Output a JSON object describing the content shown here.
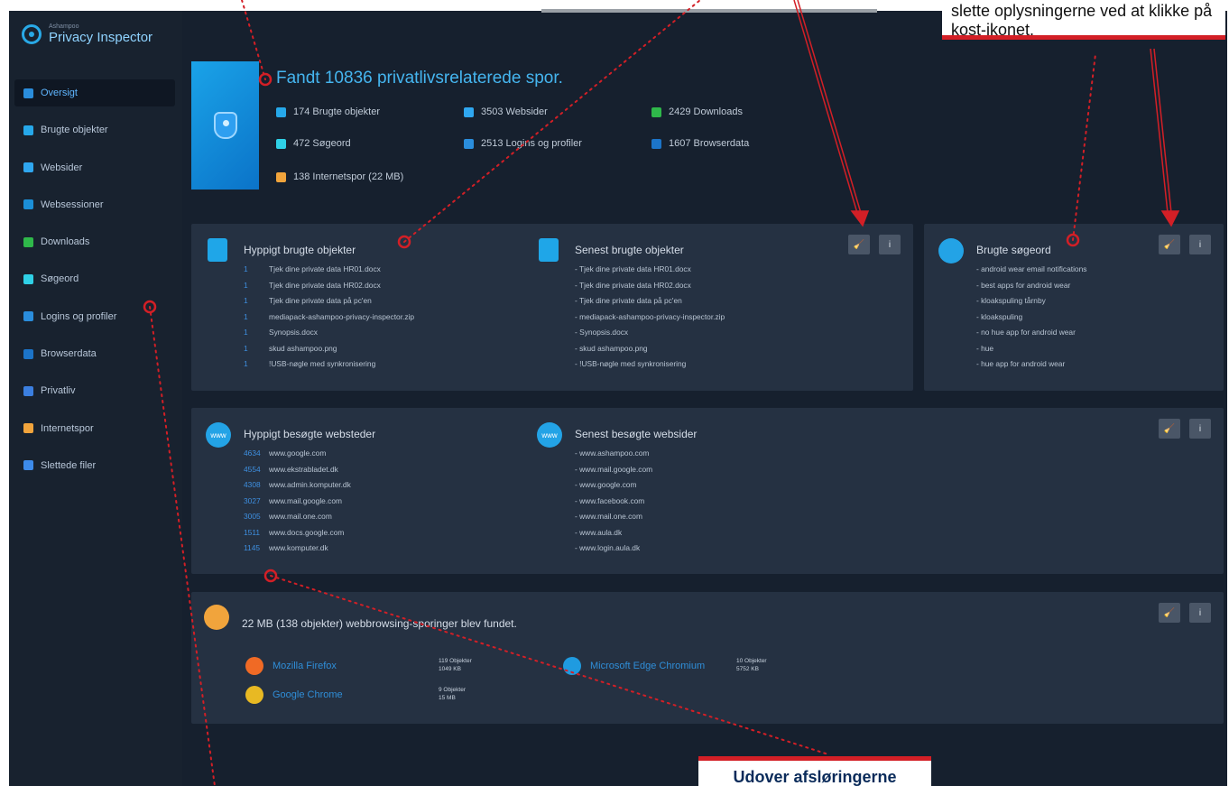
{
  "app": {
    "brand_small": "Ashampoo",
    "title": "Privacy Inspector",
    "close": "×"
  },
  "sidebar": {
    "items": [
      {
        "label": "Oversigt",
        "icon": "overview-icon",
        "color": "#2a8ddc",
        "active": true
      },
      {
        "label": "Brugte objekter",
        "icon": "file-icon",
        "color": "#26a8ea"
      },
      {
        "label": "Websider",
        "icon": "globe-icon",
        "color": "#2fa7f0"
      },
      {
        "label": "Websessioner",
        "icon": "session-icon",
        "color": "#1b8fd8"
      },
      {
        "label": "Downloads",
        "icon": "download-icon",
        "color": "#2fb84a"
      },
      {
        "label": "Søgeord",
        "icon": "search-icon",
        "color": "#2fd0e6"
      },
      {
        "label": "Logins og profiler",
        "icon": "user-icon",
        "color": "#2a8ddc"
      },
      {
        "label": "Browserdata",
        "icon": "browser-icon",
        "color": "#1c74c8"
      },
      {
        "label": "Privatliv",
        "icon": "shield-icon",
        "color": "#3b7fe0"
      },
      {
        "label": "Internetspor",
        "icon": "cookie-icon",
        "color": "#f1a43c"
      },
      {
        "label": "Slettede filer",
        "icon": "trash-icon",
        "color": "#3d8bea"
      }
    ]
  },
  "summary": {
    "title": "Fandt 10836 privatlivsrelaterede spor.",
    "stats": [
      {
        "label": "174 Brugte objekter",
        "color": "#26a8ea"
      },
      {
        "label": "3503 Websider",
        "color": "#2fa7f0"
      },
      {
        "label": "2429 Downloads",
        "color": "#2fb84a"
      },
      {
        "label": "472 Søgeord",
        "color": "#2fd0e6"
      },
      {
        "label": "2513 Logins og profiler",
        "color": "#2a8ddc"
      },
      {
        "label": "1607 Browserdata",
        "color": "#1c74c8"
      },
      {
        "label": "138 Internetspor  (22 MB)",
        "color": "#f1a43c"
      }
    ]
  },
  "objects_panel": {
    "frequent_title": "Hyppigt brugte objekter",
    "recent_title": "Senest brugte objekter",
    "frequent": [
      {
        "count": "1",
        "name": "Tjek dine private data HR01.docx"
      },
      {
        "count": "1",
        "name": "Tjek dine private data HR02.docx"
      },
      {
        "count": "1",
        "name": "Tjek dine private data på pc'en"
      },
      {
        "count": "1",
        "name": "mediapack-ashampoo-privacy-inspector.zip"
      },
      {
        "count": "1",
        "name": "Synopsis.docx"
      },
      {
        "count": "1",
        "name": "skud ashampoo.png"
      },
      {
        "count": "1",
        "name": "!USB-nøgle med synkronisering"
      }
    ],
    "recent": [
      "- Tjek dine private data HR01.docx",
      "- Tjek dine private data HR02.docx",
      "- Tjek dine private data på pc'en",
      "- mediapack-ashampoo-privacy-inspector.zip",
      "- Synopsis.docx",
      "- skud ashampoo.png",
      "- !USB-nøgle med synkronisering"
    ]
  },
  "search_panel": {
    "title": "Brugte søgeord",
    "items": [
      "- android wear email notifications",
      "- best apps for android wear",
      "- kloakspuling tårnby",
      "- kloakspuling",
      "- no hue app for android wear",
      "- hue",
      "- hue app for android wear"
    ]
  },
  "web_panel": {
    "frequent_title": "Hyppigt besøgte websteder",
    "recent_title": "Senest besøgte websider",
    "icon_text": "www",
    "frequent": [
      {
        "count": "4634",
        "site": "www.google.com"
      },
      {
        "count": "4554",
        "site": "www.ekstrabladet.dk"
      },
      {
        "count": "4308",
        "site": "www.admin.komputer.dk"
      },
      {
        "count": "3027",
        "site": "www.mail.google.com"
      },
      {
        "count": "3005",
        "site": "www.mail.one.com"
      },
      {
        "count": "1511",
        "site": "www.docs.google.com"
      },
      {
        "count": "1145",
        "site": "www.komputer.dk"
      }
    ],
    "recent": [
      "- www.ashampoo.com",
      "- www.mail.google.com",
      "- www.google.com",
      "- www.facebook.com",
      "- www.mail.one.com",
      "- www.aula.dk",
      "- www.login.aula.dk"
    ]
  },
  "tracking_panel": {
    "title": "22 MB (138 objekter) webbrowsing-sporinger blev fundet.",
    "browsers": [
      {
        "name": "Mozilla Firefox",
        "objects": "119 Objekter",
        "size": "1049 KB",
        "color": "#f06a25"
      },
      {
        "name": "Google Chrome",
        "objects": "9 Objekter",
        "size": "15 MB",
        "color": "#e8b923"
      },
      {
        "name": "Microsoft Edge Chromium",
        "objects": "10 Objekter",
        "size": "5752 KB",
        "color": "#1f9be0"
      }
    ]
  },
  "buttons": {
    "clean": "🧹",
    "info": "i"
  },
  "annotations": {
    "callout_right": "slette oplysningerne ved at klikke på kost-ikonet.",
    "callout_bottom": "Udover afsløringerne",
    "accent": "#d31f26"
  }
}
